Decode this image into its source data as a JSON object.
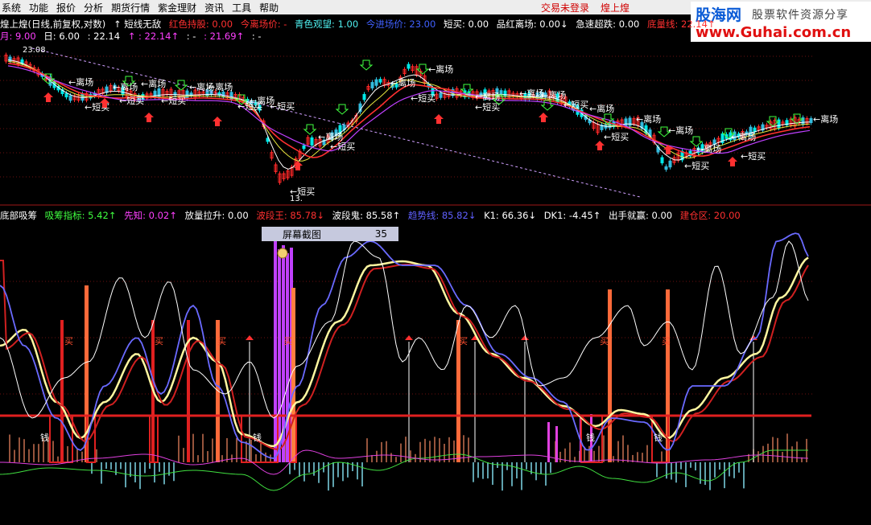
{
  "menu": [
    "系统",
    "功能",
    "报价",
    "分析",
    "期货行情",
    "紫金理财",
    "资讯",
    "工具",
    "帮助"
  ],
  "status": {
    "login": "交易未登录",
    "stock": "煌上煌"
  },
  "logo": {
    "line1": "股海网",
    "line1b": "股票软件资源分享",
    "line2": "www.Guhai.com.cn"
  },
  "upper_title": "煌上煌(日线,前复权,对数)",
  "upper_indicators": [
    {
      "text": "↑ 短线无敌",
      "color": "#ffffff"
    },
    {
      "text": "红色持股: 0.00",
      "color": "#ff3030"
    },
    {
      "text": "今离场价: -",
      "color": "#ff3030"
    },
    {
      "text": "青色观望: 1.00",
      "color": "#4ff0f0"
    },
    {
      "text": "今进场价: 23.00",
      "color": "#4060ff"
    },
    {
      "text": "短买: 0.00",
      "color": "#ffffff"
    },
    {
      "text": "品红离场: 0.00↓",
      "color": "#ffffff"
    },
    {
      "text": "急速超跌: 0.00",
      "color": "#ffffff"
    },
    {
      "text": "底量线: 22.14↑",
      "color": "#ff3030"
    }
  ],
  "upper_line2": [
    {
      "text": "月: 9.00",
      "color": "#ff40ff"
    },
    {
      "text": "日: 6.00",
      "color": "#ffffff"
    },
    {
      "text": ": 22.14",
      "color": "#ffffff"
    },
    {
      "text": "↑ : 22.14↑",
      "color": "#ff40ff"
    },
    {
      "text": ": -",
      "color": "#ffffff"
    },
    {
      "text": ": 21.69↑",
      "color": "#ff40ff"
    },
    {
      "text": ": -",
      "color": "#ffffff"
    }
  ],
  "price_label_top": "23.08",
  "price_label_low": "13.",
  "lower_title": "底部吸筹",
  "lower_indicators": [
    {
      "text": "吸筹指标: 5.42↑",
      "color": "#40ff40"
    },
    {
      "text": "先知: 0.02↑",
      "color": "#ff40ff"
    },
    {
      "text": "放量拉升: 0.00",
      "color": "#ffffff"
    },
    {
      "text": "波段王: 85.78↓",
      "color": "#ff3030"
    },
    {
      "text": "波段鬼: 85.58↑",
      "color": "#ffffff"
    },
    {
      "text": "趋势线: 85.82↓",
      "color": "#6060ff"
    },
    {
      "text": "K1: 66.36↓",
      "color": "#ffffff"
    },
    {
      "text": "DK1: -4.45↑",
      "color": "#ffffff"
    },
    {
      "text": "出手就赢: 0.00",
      "color": "#ffffff"
    },
    {
      "text": "建仓区: 20.00",
      "color": "#ff3030"
    }
  ],
  "tooltip": {
    "label": "屏幕截图",
    "value": "35"
  },
  "signals": {
    "leave": "离场",
    "buy": "短买",
    "b": "买",
    "q": "钱"
  }
}
